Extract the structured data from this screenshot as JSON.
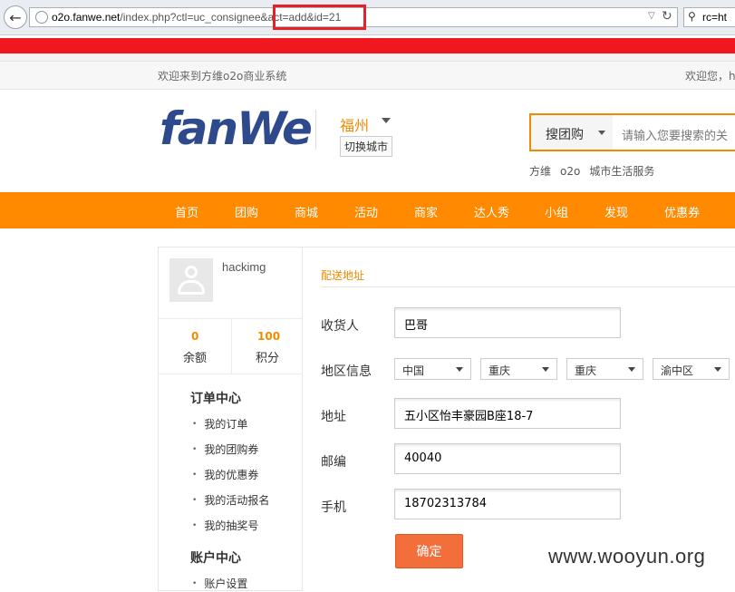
{
  "browser": {
    "url_host": "o2o.fanwe.net",
    "url_path": "/index.php?ctl=uc_consignee&act=add&id=21",
    "search_text": "rc=ht"
  },
  "topbar": {
    "welcome": "欢迎来到方维o2o商业系统",
    "user_greeting": "欢迎您，h"
  },
  "header": {
    "logo_text": "fanWe",
    "city": "福州",
    "switch_city": "切换城市",
    "search_type": "搜团购",
    "search_placeholder": "请输入您要搜索的关",
    "tags": [
      "方维",
      "o2o",
      "城市生活服务"
    ]
  },
  "nav": [
    "首页",
    "团购",
    "商城",
    "活动",
    "商家",
    "达人秀",
    "小组",
    "发现",
    "优惠券"
  ],
  "sidebar": {
    "username": "hackimg",
    "balance_value": "0",
    "balance_label": "余额",
    "points_value": "100",
    "points_label": "积分",
    "order_center": "订单中心",
    "order_items": [
      "我的订单",
      "我的团购券",
      "我的优惠券",
      "我的活动报名",
      "我的抽奖号"
    ],
    "account_center": "账户中心",
    "account_items": [
      "账户设置"
    ]
  },
  "form": {
    "title": "配送地址",
    "consignee_label": "收货人",
    "consignee_value": "巴哥",
    "region_label": "地区信息",
    "regions": [
      "中国",
      "重庆",
      "重庆",
      "渝中区"
    ],
    "address_label": "地址",
    "address_value": "五小区怡丰豪园B座18-7",
    "zip_label": "邮编",
    "zip_value": "40040",
    "mobile_label": "手机",
    "mobile_value": "18702313784",
    "confirm_label": "确定"
  },
  "watermark": "www.wooyun.org",
  "colors": {
    "accent": "#ff8a00",
    "highlight": "#e8202a",
    "button": "#f26f3c"
  }
}
